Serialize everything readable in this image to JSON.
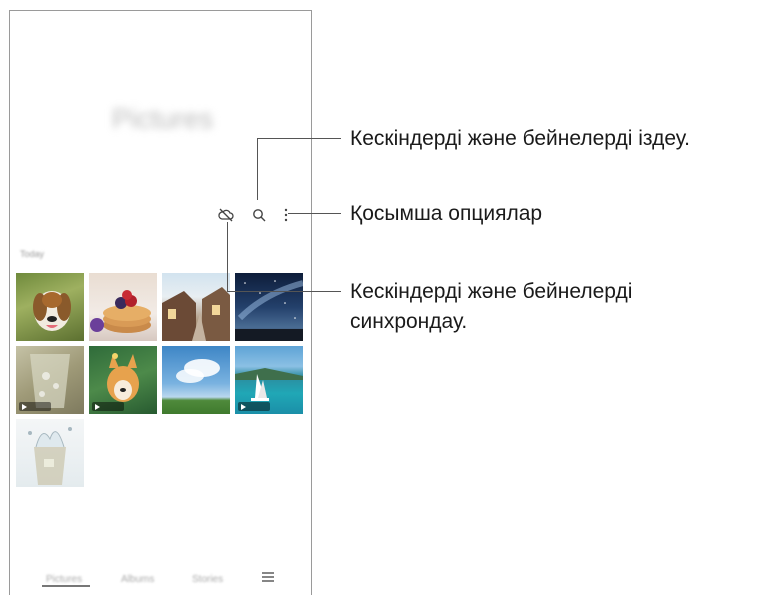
{
  "app": {
    "title": "Pictures"
  },
  "toolbar": {
    "sync_icon": "cloud-off-icon",
    "search_icon": "search-icon",
    "more_icon": "more-options-icon"
  },
  "gallery": {
    "section_label": "Today",
    "thumbnails": [
      {
        "name": "photo-beagle",
        "video": false
      },
      {
        "name": "photo-pancakes",
        "video": false
      },
      {
        "name": "photo-village-street",
        "video": false
      },
      {
        "name": "photo-night-sky",
        "video": false
      },
      {
        "name": "photo-water-glass",
        "video": true
      },
      {
        "name": "photo-corgi",
        "video": true
      },
      {
        "name": "photo-sky-field",
        "video": false
      },
      {
        "name": "photo-sailboat",
        "video": true
      },
      {
        "name": "photo-splash",
        "video": false
      }
    ]
  },
  "bottom_nav": {
    "tabs": [
      "Pictures",
      "Albums",
      "Stories"
    ],
    "menu_icon": "menu-icon"
  },
  "callouts": {
    "search": "Кескіндерді және бейнелерді іздеу.",
    "options": "Қосымша опциялар",
    "sync_line1": "Кескіндерді және бейнелерді",
    "sync_line2": "синхрондау."
  }
}
